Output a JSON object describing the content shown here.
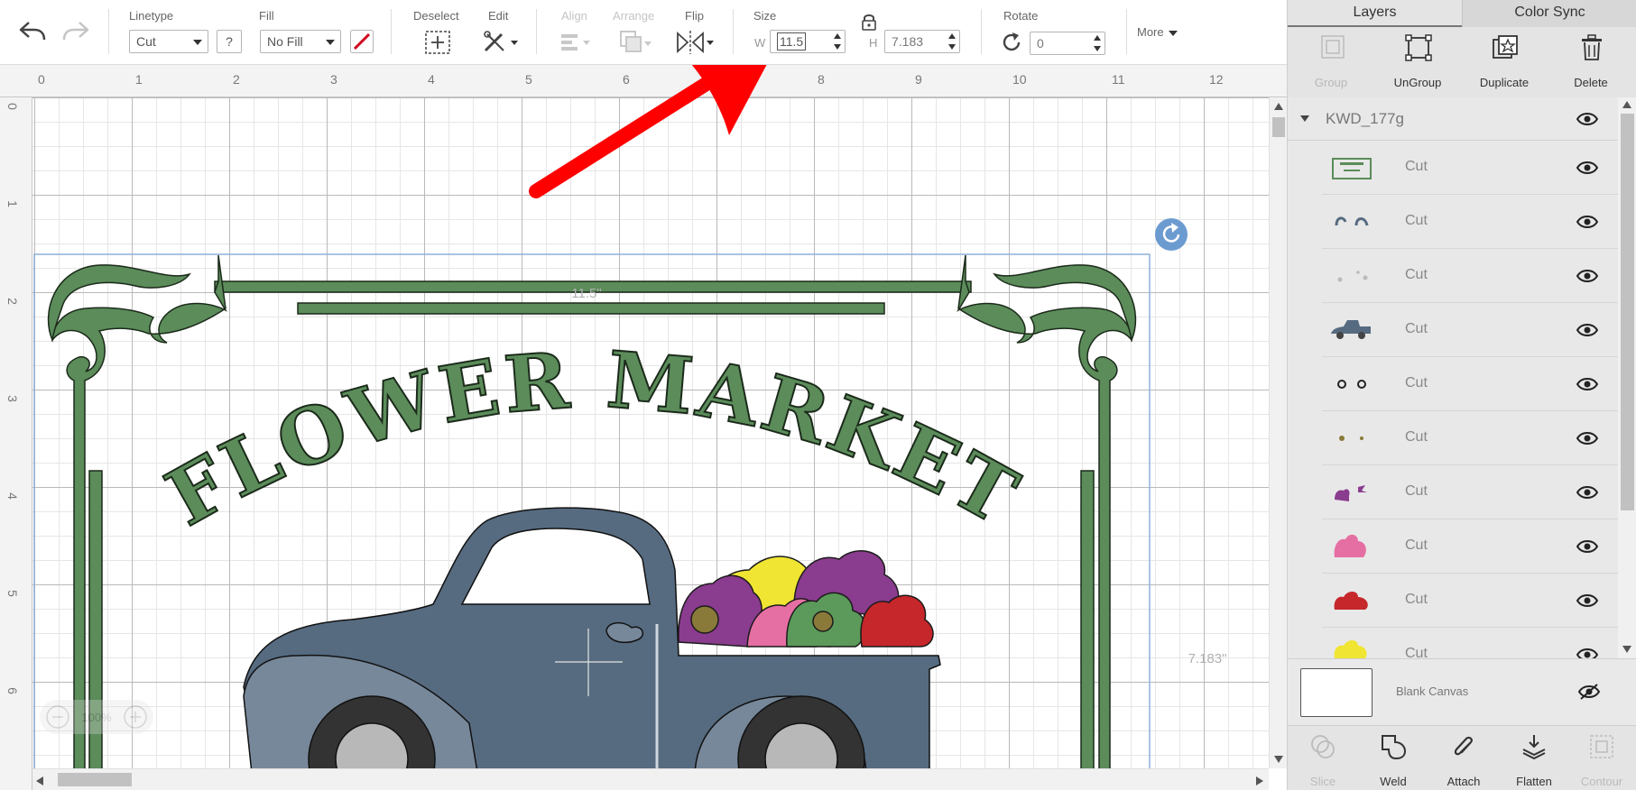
{
  "toolbar": {
    "linetype": {
      "label": "Linetype",
      "value": "Cut",
      "help": "?"
    },
    "fill": {
      "label": "Fill",
      "value": "No Fill"
    },
    "deselect_label": "Deselect",
    "edit_label": "Edit",
    "align_label": "Align",
    "arrange_label": "Arrange",
    "flip_label": "Flip",
    "size": {
      "label": "Size",
      "w_label": "W",
      "w_value": "11.5",
      "h_label": "H",
      "h_value": "7.183"
    },
    "rotate": {
      "label": "Rotate",
      "value": "0"
    },
    "more_label": "More"
  },
  "canvas": {
    "ruler_top": [
      "0",
      "1",
      "2",
      "3",
      "4",
      "5",
      "6",
      "7",
      "8",
      "9",
      "10",
      "11",
      "12"
    ],
    "ruler_left": [
      "0",
      "1",
      "2",
      "3",
      "4",
      "5",
      "6"
    ],
    "width_dim": "11.5\"",
    "height_dim": "7.183\"",
    "artwork_title": "FLOWER MARKET",
    "zoom_label": "100%"
  },
  "panel": {
    "tabs": [
      "Layers",
      "Color Sync"
    ],
    "actions": [
      {
        "label": "Group",
        "icon": "group-icon",
        "enabled": false
      },
      {
        "label": "UnGroup",
        "icon": "ungroup-icon",
        "enabled": true
      },
      {
        "label": "Duplicate",
        "icon": "duplicate-icon",
        "enabled": true
      },
      {
        "label": "Delete",
        "icon": "trash-icon",
        "enabled": true
      }
    ],
    "group_name": "KWD_177g",
    "layers": [
      {
        "name": "Cut",
        "thumb": "frame"
      },
      {
        "name": "Cut",
        "thumb": "swirls"
      },
      {
        "name": "Cut",
        "thumb": "dots-light"
      },
      {
        "name": "Cut",
        "thumb": "truck"
      },
      {
        "name": "Cut",
        "thumb": "rings"
      },
      {
        "name": "Cut",
        "thumb": "dots-brown"
      },
      {
        "name": "Cut",
        "thumb": "purple-flower"
      },
      {
        "name": "Cut",
        "thumb": "pink-flower"
      },
      {
        "name": "Cut",
        "thumb": "red-flower"
      },
      {
        "name": "Cut",
        "thumb": "yellow-flower"
      }
    ],
    "blank_canvas_label": "Blank Canvas",
    "bottom_actions": [
      {
        "label": "Slice",
        "icon": "slice-icon",
        "enabled": false
      },
      {
        "label": "Weld",
        "icon": "weld-icon",
        "enabled": true
      },
      {
        "label": "Attach",
        "icon": "paperclip-icon",
        "enabled": true
      },
      {
        "label": "Flatten",
        "icon": "flatten-icon",
        "enabled": true
      },
      {
        "label": "Contour",
        "icon": "contour-icon",
        "enabled": false
      }
    ]
  },
  "colors": {
    "green": "#5b8c5a",
    "truck_body": "#566b80",
    "truck_fender": "#77889a",
    "arrow": "#ff0000",
    "selection": "#8fb0d8"
  }
}
